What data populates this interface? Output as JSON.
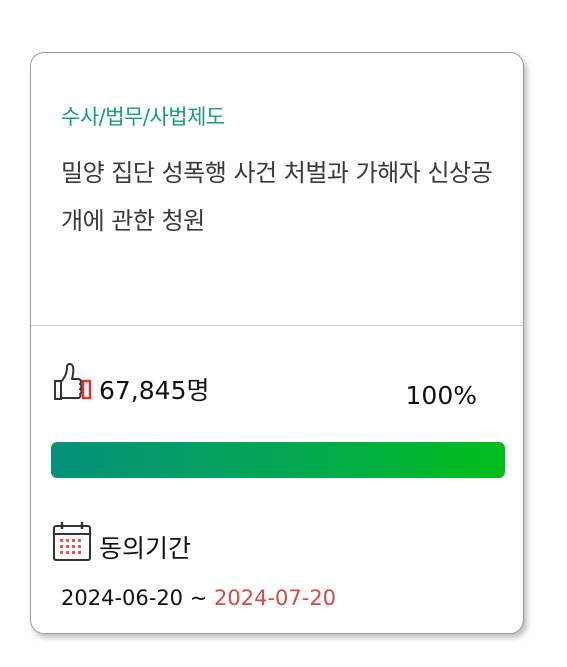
{
  "petition": {
    "category": "수사/법무/사법제도",
    "title": "밀양 집단 성폭행 사건 처벌과 가해자 신상공개에 관한 청원",
    "agree_count": "67,845명",
    "percent_text": "100%",
    "progress_fraction": 1.0,
    "period_label": "동의기간",
    "start_date": "2024-06-20",
    "date_separator": " ~ ",
    "end_date": "2024-07-20"
  },
  "icons": {
    "agree": "thumbs-up-icon",
    "period": "calendar-icon"
  },
  "colors": {
    "category": "#1a9a7f",
    "progress_start": "#04907a",
    "progress_end": "#00be18",
    "end_date": "#d04b45",
    "thumb_accent": "#e0302a",
    "calendar_dots": "#e05a4a"
  }
}
